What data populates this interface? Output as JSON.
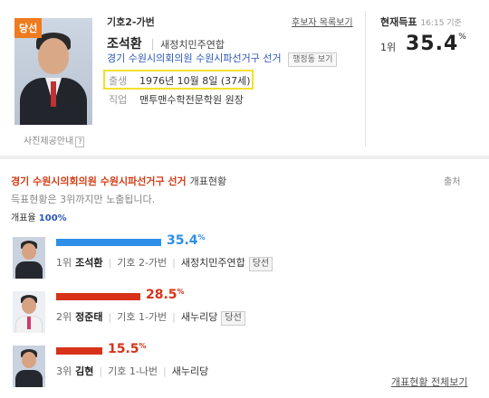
{
  "profile": {
    "badge": "당선",
    "photo_caption": "사진제공안내",
    "help_mark": "?",
    "seat_no": "기호2-가번",
    "name": "조석환",
    "party": "새정치민주연합",
    "district": "경기 수원시의회의원 수원시파선거구 선거",
    "admin_btn": "행정동 보기",
    "birth_label": "출생",
    "birth_value": "1976년 10월 8일 (37세)",
    "job_label": "직업",
    "job_value": "맨투맨수학전문학원 원장",
    "candidate_list_link": "후보자 목록보기",
    "current_title": "현재득표",
    "current_time": "16:15 기준",
    "current_rank": "1위",
    "current_pct": "35.4",
    "pct_unit": "%"
  },
  "results": {
    "title_red": "경기 수원시의회의원 수원시파선거구 선거",
    "title_sub": "개표현황",
    "share_label": "출처",
    "note": "득표현황은 3위까지만 노출됩니다.",
    "count_label": "개표율",
    "count_value": "100%",
    "candidates": [
      {
        "pct": "35.4",
        "pct_num": 35.4,
        "rank": "1위",
        "name": "조석환",
        "no": "기호 2-가번",
        "party": "새정치민주연합",
        "elected": "당선",
        "color": "#2d8fe8"
      },
      {
        "pct": "28.5",
        "pct_num": 28.5,
        "rank": "2위",
        "name": "정준태",
        "no": "기호 1-가번",
        "party": "새누리당",
        "elected": "당선",
        "color": "#d8321a"
      },
      {
        "pct": "15.5",
        "pct_num": 15.5,
        "rank": "3위",
        "name": "김현",
        "no": "기호 1-나번",
        "party": "새누리당",
        "elected": "",
        "color": "#d8321a"
      }
    ],
    "unit": "%",
    "all_link": "개표현황 전체보기"
  }
}
